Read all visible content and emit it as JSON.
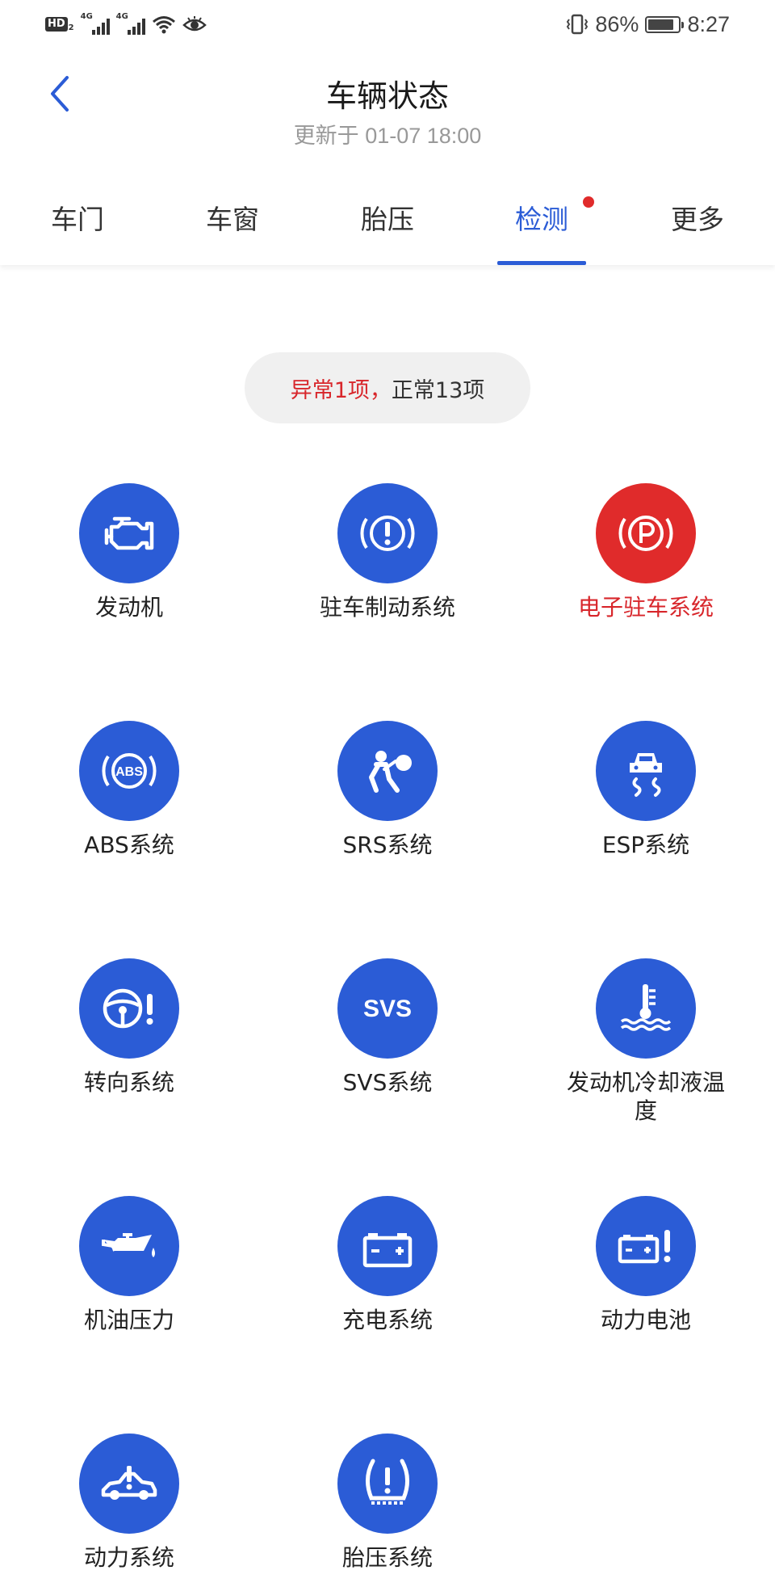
{
  "status_bar": {
    "hd_label": "HD",
    "hd_sub": "2",
    "sig1_tag": "4G",
    "sig2_tag": "4G",
    "battery": "86%",
    "battery_level": 0.86,
    "time": "8:27"
  },
  "header": {
    "title": "车辆状态",
    "updated": "更新于 01-07 18:00"
  },
  "tabs": [
    {
      "label": "车门",
      "active": false
    },
    {
      "label": "车窗",
      "active": false
    },
    {
      "label": "胎压",
      "active": false
    },
    {
      "label": "检测",
      "active": true,
      "has_dot": true
    },
    {
      "label": "更多",
      "active": false
    }
  ],
  "summary": {
    "abnormal": "异常1项，",
    "normal": "正常13项"
  },
  "colors": {
    "accent": "#2b5cd6",
    "alert": "#e02b2b",
    "alert_text": "#d8262b"
  },
  "items": [
    {
      "label": "发动机",
      "icon": "engine-icon",
      "status": "normal"
    },
    {
      "label": "驻车制动系统",
      "icon": "brake-warning-icon",
      "status": "normal"
    },
    {
      "label": "电子驻车系统",
      "icon": "parking-brake-icon",
      "status": "abnormal"
    },
    {
      "label": "ABS系统",
      "icon": "abs-icon",
      "status": "normal"
    },
    {
      "label": "SRS系统",
      "icon": "airbag-icon",
      "status": "normal"
    },
    {
      "label": "ESP系统",
      "icon": "esp-icon",
      "status": "normal"
    },
    {
      "label": "转向系统",
      "icon": "steering-warning-icon",
      "status": "normal"
    },
    {
      "label": "SVS系统",
      "icon": "svs-icon",
      "status": "normal",
      "icon_text": "SVS"
    },
    {
      "label": "发动机冷却液温度",
      "icon": "coolant-temp-icon",
      "status": "normal"
    },
    {
      "label": "机油压力",
      "icon": "oil-pressure-icon",
      "status": "normal"
    },
    {
      "label": "充电系统",
      "icon": "battery-charge-icon",
      "status": "normal"
    },
    {
      "label": "动力电池",
      "icon": "power-battery-icon",
      "status": "normal"
    },
    {
      "label": "动力系统",
      "icon": "powertrain-icon",
      "status": "normal"
    },
    {
      "label": "胎压系统",
      "icon": "tire-pressure-icon",
      "status": "normal"
    }
  ]
}
